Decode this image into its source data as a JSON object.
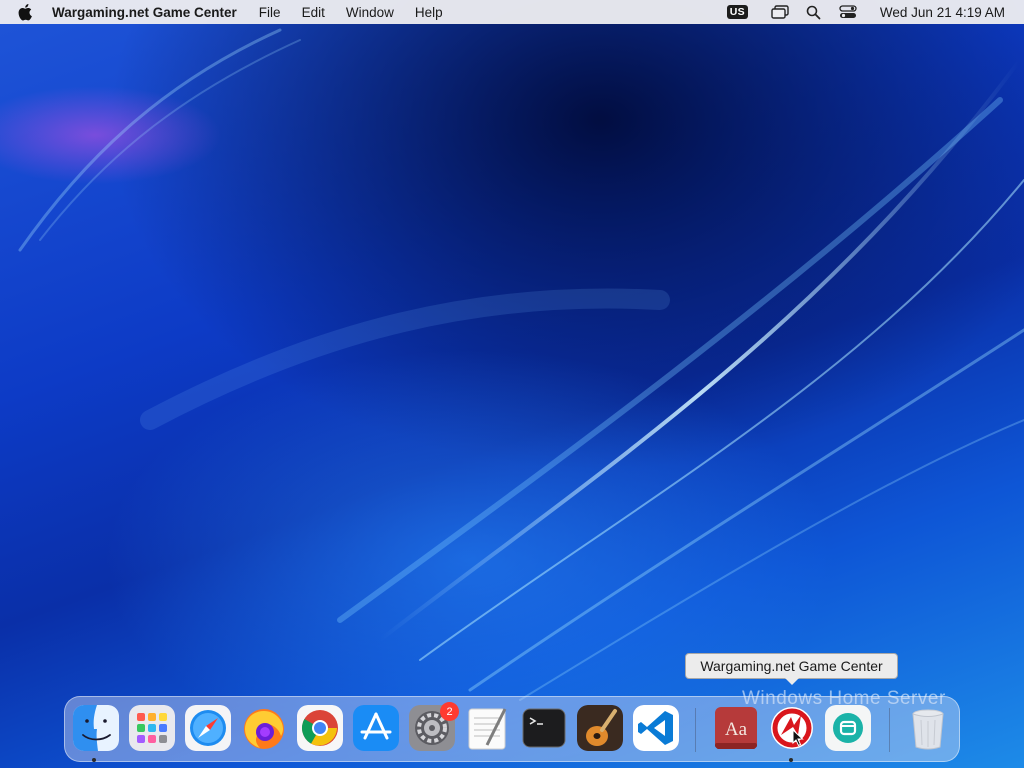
{
  "menubar": {
    "app_name": "Wargaming.net Game Center",
    "menus": [
      "File",
      "Edit",
      "Window",
      "Help"
    ],
    "input_source": "US",
    "clock": "Wed Jun 21  4:19 AM",
    "icons": [
      "apple-icon",
      "screen-mirroring-icon",
      "spotlight-search-icon",
      "control-center-icon"
    ]
  },
  "tooltip": {
    "text": "Wargaming.net Game Center"
  },
  "desktop": {
    "watermark": "Windows Home Server"
  },
  "dock": {
    "apps": [
      {
        "name": "Finder",
        "icon": "finder-icon",
        "running": true
      },
      {
        "name": "Launchpad",
        "icon": "launchpad-icon",
        "running": false
      },
      {
        "name": "Safari",
        "icon": "safari-icon",
        "running": false
      },
      {
        "name": "Firefox",
        "icon": "firefox-icon",
        "running": false
      },
      {
        "name": "Google Chrome",
        "icon": "chrome-icon",
        "running": false
      },
      {
        "name": "App Store",
        "icon": "app-store-icon",
        "running": false
      },
      {
        "name": "System Preferences",
        "icon": "system-preferences-icon",
        "running": false,
        "badge": "2"
      },
      {
        "name": "TextEdit",
        "icon": "textedit-icon",
        "running": false
      },
      {
        "name": "Terminal",
        "icon": "terminal-icon",
        "running": false
      },
      {
        "name": "GarageBand",
        "icon": "garageband-icon",
        "running": false
      },
      {
        "name": "Visual Studio Code",
        "icon": "vscode-icon",
        "running": false
      },
      {
        "name": "Dictionary",
        "icon": "dictionary-icon",
        "running": false
      },
      {
        "name": "Wargaming.net Game Center",
        "icon": "wargaming-icon",
        "running": true
      },
      {
        "name": "Unknown App",
        "icon": "teal-app-icon",
        "running": false
      },
      {
        "name": "Trash",
        "icon": "trash-icon",
        "running": false
      }
    ]
  },
  "colors": {
    "badge": "#ff3b30",
    "wallpaper": "#0d3bc6"
  }
}
